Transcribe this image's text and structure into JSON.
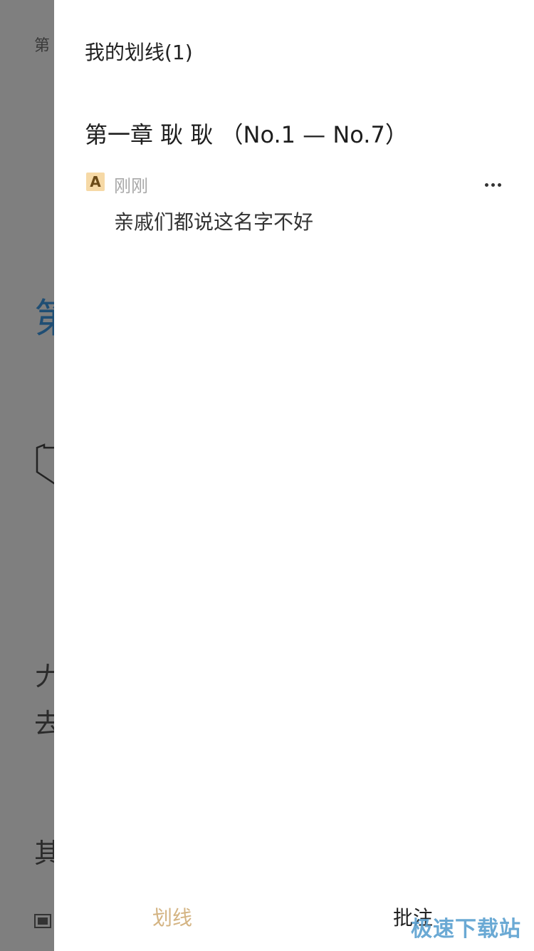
{
  "background": {
    "header_fragment": "第",
    "chapter_fragment": "第",
    "line1_fragment": "𠂇",
    "line2_fragment": "去",
    "line3_fragment": "其"
  },
  "drawer": {
    "title": "我的划线(1)",
    "chapter_title": "第一章 耿 耿 （No.1 — No.7）",
    "note": {
      "badge": "A",
      "time": "刚刚",
      "text": "亲戚们都说这名字不好"
    }
  },
  "tabs": {
    "highlights": "划线",
    "annotations": "批注"
  },
  "watermark": "极速下载站",
  "colors": {
    "accent": "#d4b483",
    "badge_bg": "#f6d9a6",
    "overlay": "#7f7f7f",
    "chapter_blue": "#1f4e74"
  }
}
